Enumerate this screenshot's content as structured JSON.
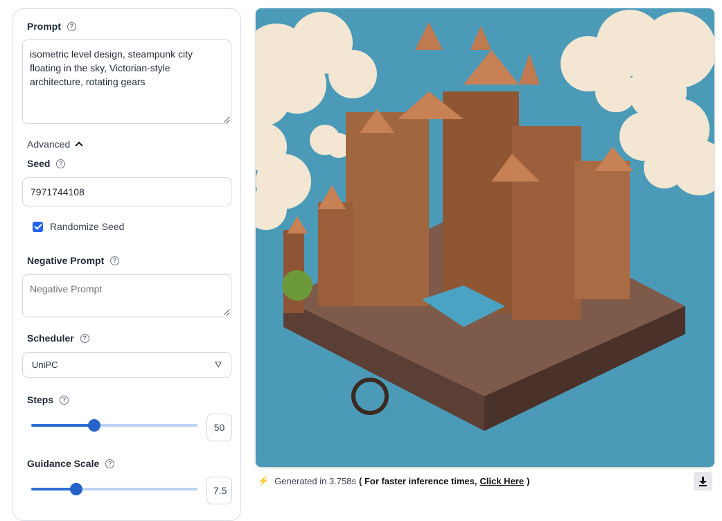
{
  "form": {
    "prompt_label": "Prompt",
    "prompt_value": "isometric level design, steampunk city floating in the sky, Victorian-style architecture, rotating gears",
    "advanced_label": "Advanced",
    "seed_label": "Seed",
    "seed_value": "7971744108",
    "randomize_label": "Randomize Seed",
    "randomize_checked": true,
    "negative_label": "Negative Prompt",
    "negative_placeholder": "Negative Prompt",
    "scheduler_label": "Scheduler",
    "scheduler_value": "UniPC",
    "steps_label": "Steps",
    "steps_value": "50",
    "steps_fraction": 0.38,
    "guidance_label": "Guidance Scale",
    "guidance_value": "7.5",
    "guidance_fraction": 0.27
  },
  "output": {
    "generated_text": "Generated in 3.758s",
    "faster_prefix": "( For faster inference times,",
    "link_text": "Click Here",
    "faster_suffix": ")",
    "bolt_icon": "lightning-icon",
    "download_icon": "download-icon"
  },
  "colors": {
    "accent": "#2563eb",
    "sky": "#4b9ab8",
    "bolt": "#f97316"
  }
}
